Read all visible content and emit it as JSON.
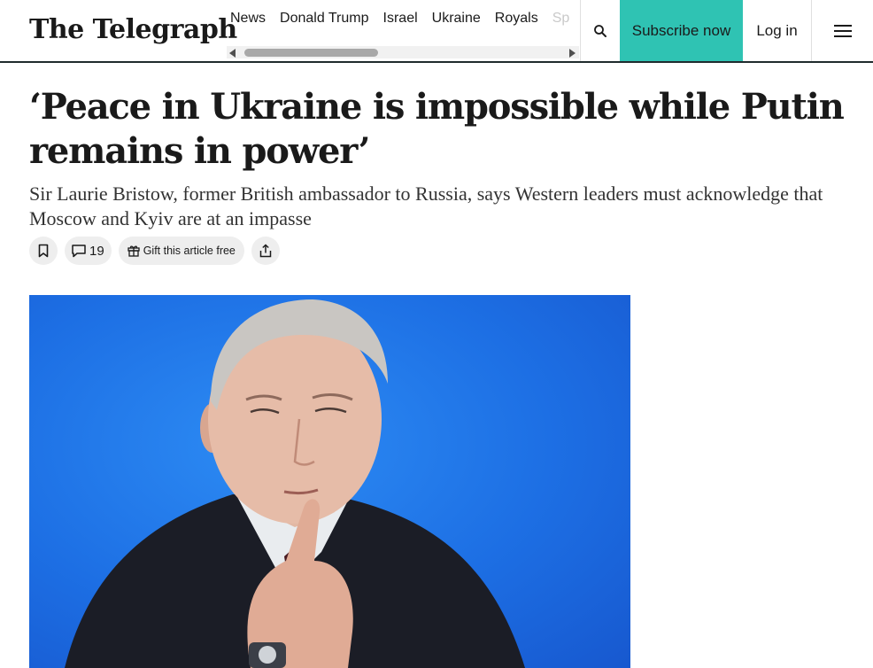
{
  "header": {
    "logo": "The Telegraph",
    "nav": [
      "News",
      "Donald Trump",
      "Israel",
      "Ukraine",
      "Royals",
      "Sp"
    ],
    "search_icon": "search-icon",
    "subscribe_label": "Subscribe now",
    "login_label": "Log in",
    "menu_icon": "hamburger-menu-icon"
  },
  "article": {
    "headline": "‘Peace in Ukraine is impossible while Putin remains in power’",
    "standfirst": "Sir Laurie Bristow, former British ambassador to Russia, says Western leaders must acknowledge that Moscow and Kyiv are at an impasse",
    "actions": {
      "bookmark_icon": "bookmark-icon",
      "comments_icon": "comment-icon",
      "comment_count": "19",
      "gift_icon": "gift-icon",
      "gift_label": "Gift this article free",
      "share_icon": "share-icon"
    }
  },
  "colors": {
    "subscribe": "#2fc3b3",
    "header_rule": "#1f2b2d",
    "pill_bg": "#eeeeee",
    "photo_bg": "#1d6fe4"
  }
}
